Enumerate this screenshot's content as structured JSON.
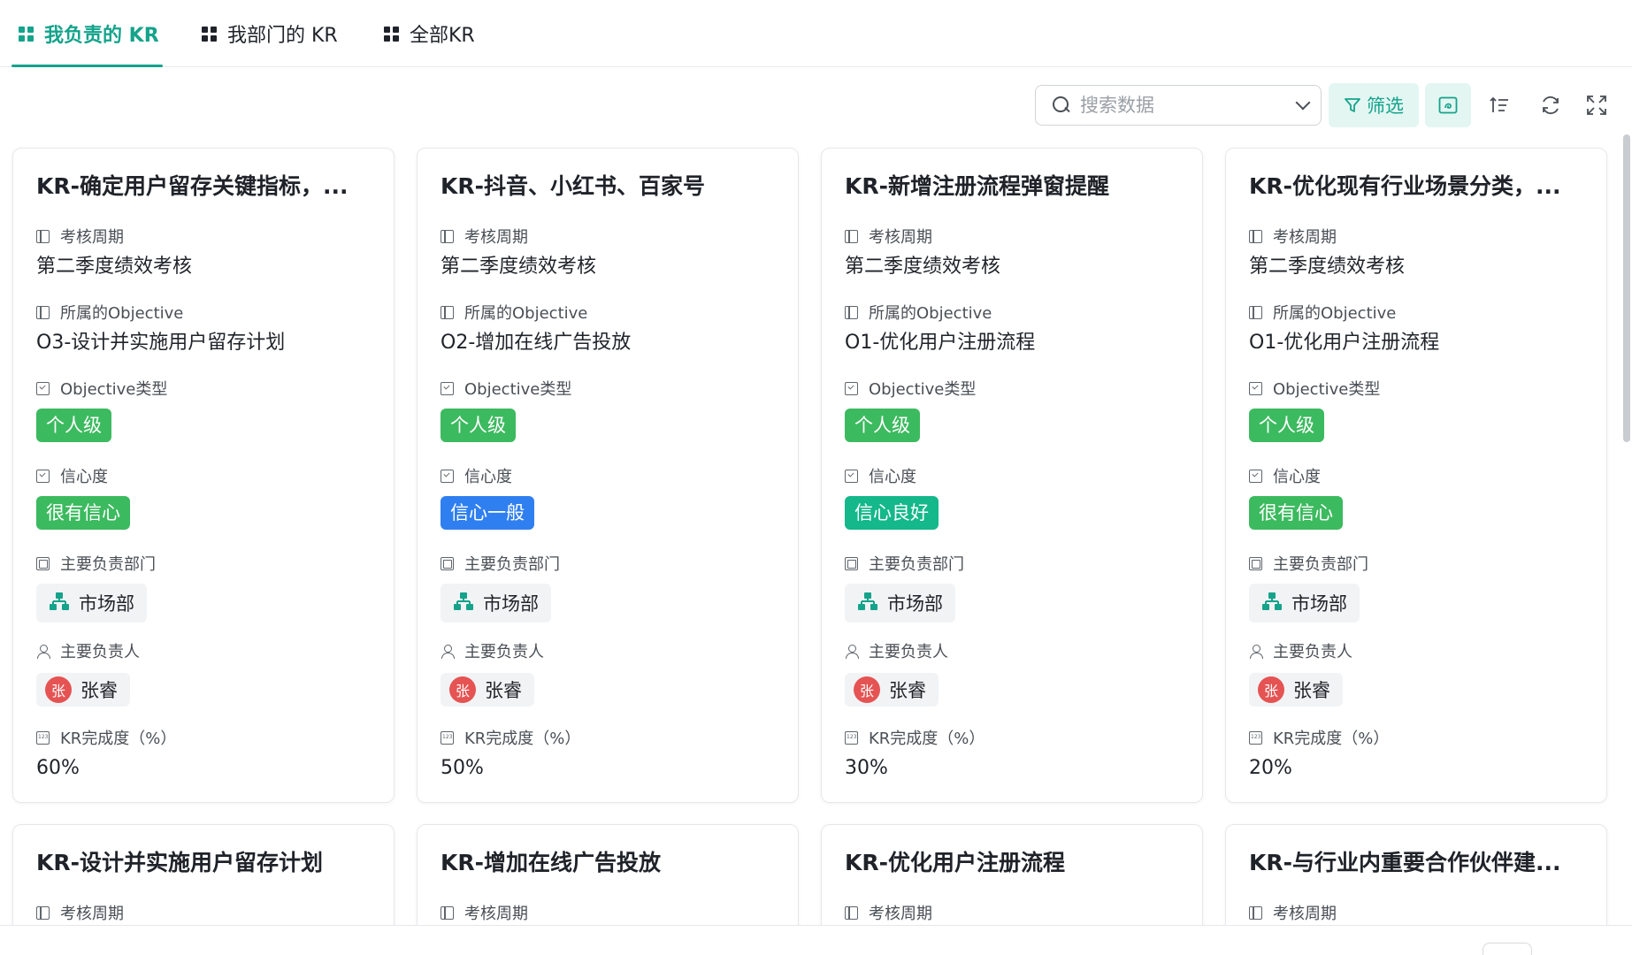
{
  "tabs": [
    {
      "label": "我负责的 KR",
      "active": true
    },
    {
      "label": "我部门的 KR",
      "active": false
    },
    {
      "label": "全部KR",
      "active": false
    }
  ],
  "toolbar": {
    "search_placeholder": "搜索数据",
    "filter_label": "筛选"
  },
  "field_labels": {
    "period": "考核周期",
    "objective": "所属的Objective",
    "objective_type": "Objective类型",
    "confidence": "信心度",
    "dept": "主要负责部门",
    "owner": "主要负责人",
    "progress": "KR完成度（%）"
  },
  "colors": {
    "accent": "#14a38b",
    "tag_personal": "#3cba5f",
    "confidence_high": "#3cba5f",
    "confidence_medium": "#2f7ff0",
    "confidence_good": "#14b88a",
    "avatar": "#e55353"
  },
  "cards": [
    {
      "title": "KR-确定用户留存关键指标，...",
      "period": "第二季度绩效考核",
      "objective": "O3-设计并实施用户留存计划",
      "objective_type": "个人级",
      "confidence": "很有信心",
      "dept": "市场部",
      "owner_initial": "张",
      "owner": "张睿",
      "progress": "60%"
    },
    {
      "title": "KR-抖音、小红书、百家号",
      "period": "第二季度绩效考核",
      "objective": "O2-增加在线广告投放",
      "objective_type": "个人级",
      "confidence": "信心一般",
      "dept": "市场部",
      "owner_initial": "张",
      "owner": "张睿",
      "progress": "50%"
    },
    {
      "title": "KR-新增注册流程弹窗提醒",
      "period": "第二季度绩效考核",
      "objective": "O1-优化用户注册流程",
      "objective_type": "个人级",
      "confidence": "信心良好",
      "dept": "市场部",
      "owner_initial": "张",
      "owner": "张睿",
      "progress": "30%"
    },
    {
      "title": "KR-优化现有行业场景分类，...",
      "period": "第二季度绩效考核",
      "objective": "O1-优化用户注册流程",
      "objective_type": "个人级",
      "confidence": "很有信心",
      "dept": "市场部",
      "owner_initial": "张",
      "owner": "张睿",
      "progress": "20%"
    }
  ],
  "cards_row2": [
    {
      "title": "KR-设计并实施用户留存计划"
    },
    {
      "title": "KR-增加在线广告投放"
    },
    {
      "title": "KR-优化用户注册流程"
    },
    {
      "title": "KR-与行业内重要合作伙伴建..."
    }
  ]
}
